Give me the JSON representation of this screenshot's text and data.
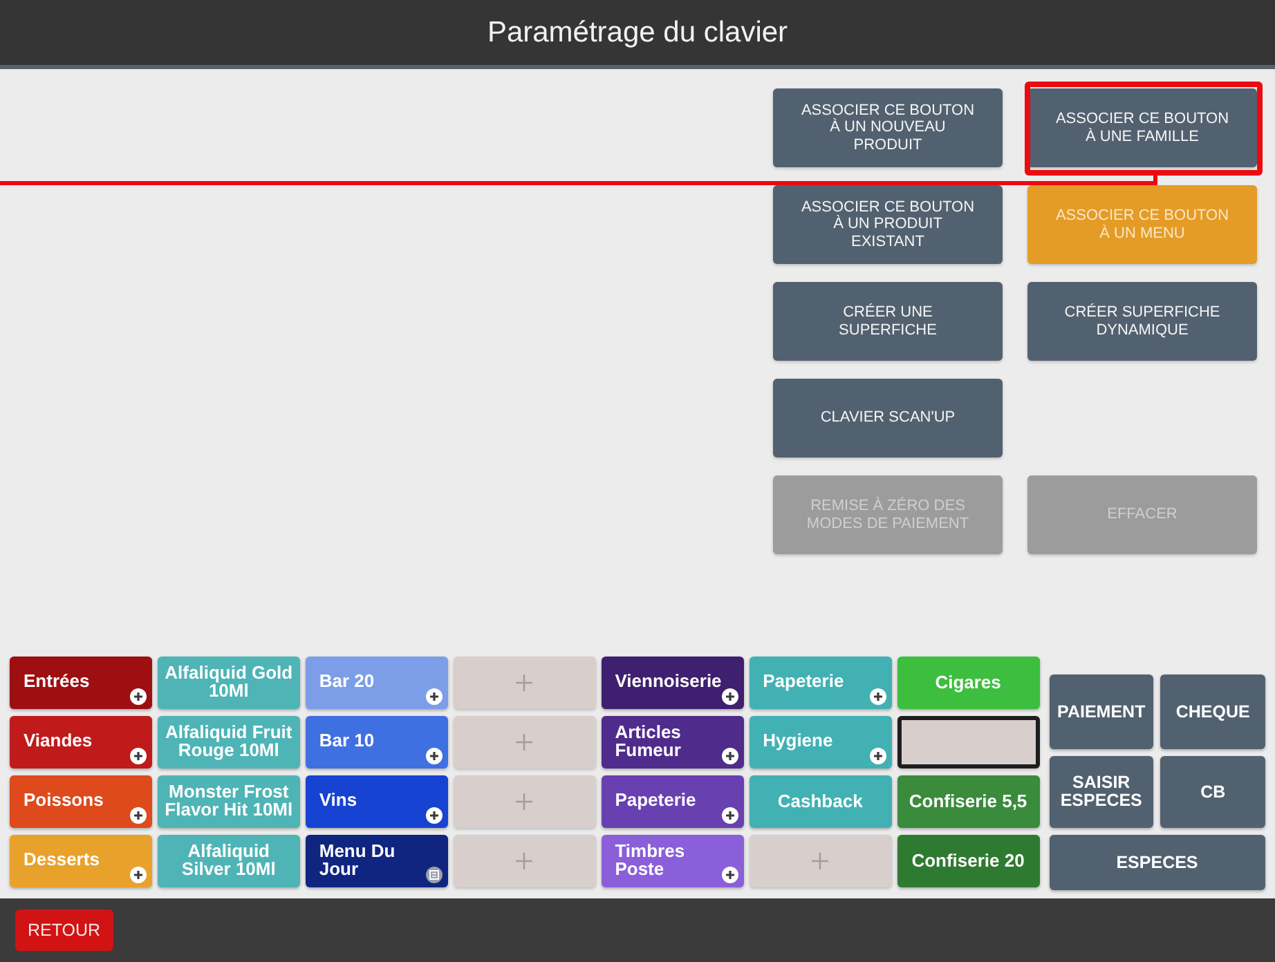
{
  "header": {
    "title": "Paramétrage du clavier"
  },
  "actions": [
    [
      {
        "label": "ASSOCIER CE BOUTON À UN NOUVEAU PRODUIT",
        "selected": false,
        "disabled": false,
        "highlighted": false
      },
      {
        "label": "ASSOCIER CE BOUTON À UNE FAMILLE",
        "selected": false,
        "disabled": false,
        "highlighted": true
      }
    ],
    [
      {
        "label": "ASSOCIER CE BOUTON À UN PRODUIT EXISTANT",
        "selected": false,
        "disabled": false,
        "highlighted": false
      },
      {
        "label": "ASSOCIER CE BOUTON À UN MENU",
        "selected": true,
        "disabled": false,
        "highlighted": false
      }
    ],
    [
      {
        "label": "CRÉER UNE SUPERFICHE",
        "selected": false,
        "disabled": false,
        "highlighted": false
      },
      {
        "label": "CRÉER SUPERFICHE DYNAMIQUE",
        "selected": false,
        "disabled": false,
        "highlighted": false
      }
    ],
    [
      {
        "label": "CLAVIER SCAN'UP",
        "selected": false,
        "disabled": false,
        "highlighted": false
      }
    ],
    [
      {
        "label": "REMISE À ZÉRO DES MODES DE PAIEMENT",
        "selected": false,
        "disabled": true,
        "highlighted": false
      },
      {
        "label": "EFFACER",
        "selected": false,
        "disabled": true,
        "highlighted": false
      }
    ]
  ],
  "keys": [
    {
      "label": "Entrées",
      "kind": "family",
      "color": "#9e0f12",
      "selected": false
    },
    {
      "label": "Alfaliquid Gold 10Ml",
      "kind": "product",
      "color": "#4fb4b6",
      "selected": false
    },
    {
      "label": "Bar 20",
      "kind": "family",
      "color": "#7c9ee8",
      "selected": false
    },
    {
      "kind": "empty",
      "selected": false
    },
    {
      "label": "Viennoiserie",
      "kind": "family",
      "color": "#3f1f6f",
      "selected": false
    },
    {
      "label": "Papeterie",
      "kind": "family",
      "color": "#41b1b4",
      "selected": false
    },
    {
      "label": "Cigares",
      "kind": "product",
      "color": "#3dbe3f",
      "selected": false
    },
    {
      "label": "Viandes",
      "kind": "family",
      "color": "#c01a1a",
      "selected": false
    },
    {
      "label": "Alfaliquid Fruit Rouge 10Ml",
      "kind": "product",
      "color": "#4fb4b6",
      "selected": false
    },
    {
      "label": "Bar 10",
      "kind": "family",
      "color": "#3f70e2",
      "selected": false
    },
    {
      "kind": "empty",
      "selected": false
    },
    {
      "label": "Articles Fumeur",
      "kind": "family",
      "color": "#4f2b8c",
      "selected": false
    },
    {
      "label": "Hygiene",
      "kind": "family",
      "color": "#41b1b4",
      "selected": false
    },
    {
      "kind": "empty",
      "selected": true
    },
    {
      "label": "Poissons",
      "kind": "family",
      "color": "#de4a1c",
      "selected": false
    },
    {
      "label": "Monster Frost Flavor Hit 10Ml",
      "kind": "product",
      "color": "#4fb4b6",
      "selected": false
    },
    {
      "label": "Vins",
      "kind": "family",
      "color": "#1743d2",
      "selected": false
    },
    {
      "kind": "empty",
      "selected": false
    },
    {
      "label": "Papeterie",
      "kind": "family",
      "color": "#6940b0",
      "selected": false
    },
    {
      "label": "Cashback",
      "kind": "product",
      "color": "#41b1b4",
      "selected": false
    },
    {
      "label": "Confiserie 5,5",
      "kind": "product",
      "color": "#3a8b3c",
      "selected": false
    },
    {
      "label": "Desserts",
      "kind": "family",
      "color": "#e8a22c",
      "selected": false
    },
    {
      "label": "Alfaliquid Silver 10Ml",
      "kind": "product",
      "color": "#4fb4b6",
      "selected": false
    },
    {
      "label": "Menu Du Jour",
      "kind": "menu",
      "color": "#0f2580",
      "selected": false
    },
    {
      "kind": "empty",
      "selected": false
    },
    {
      "label": "Timbres Poste",
      "kind": "family",
      "color": "#8a5fd9",
      "selected": false
    },
    {
      "kind": "empty",
      "selected": false
    },
    {
      "label": "Confiserie 20",
      "kind": "product",
      "color": "#2f7a31",
      "selected": false
    }
  ],
  "payment_buttons": [
    {
      "label": "PAIEMENT",
      "wide": false
    },
    {
      "label": "CHEQUE",
      "wide": false
    },
    {
      "label": "SAISIR ESPECES",
      "wide": false
    },
    {
      "label": "CB",
      "wide": false
    },
    {
      "label": "ESPECES",
      "wide": true
    }
  ],
  "footer": {
    "back_button": "RETOUR"
  }
}
